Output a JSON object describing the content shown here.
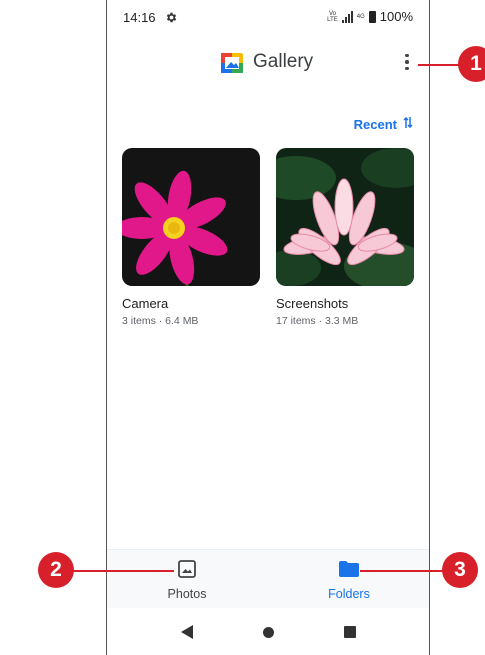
{
  "status_bar": {
    "time": "14:16",
    "volte_top": "Vo",
    "volte_bottom": "LTE",
    "network": "4G",
    "battery": "100%"
  },
  "app_bar": {
    "title": "Gallery",
    "more_icon": "more-vert-icon"
  },
  "sort": {
    "label": "Recent",
    "icon": "sort-arrows-icon"
  },
  "folders": [
    {
      "name": "Camera",
      "meta": "3 items · 6.4 MB"
    },
    {
      "name": "Screenshots",
      "meta": "17 items · 3.3 MB"
    }
  ],
  "bottom_nav": {
    "items": [
      {
        "label": "Photos",
        "icon": "image-icon",
        "active": false
      },
      {
        "label": "Folders",
        "icon": "folder-icon",
        "active": true
      }
    ]
  },
  "callouts": [
    "1",
    "2",
    "3"
  ],
  "colors": {
    "accent": "#1a73e8",
    "callout": "#d8202a",
    "nav_bg": "#f8f9fa"
  }
}
